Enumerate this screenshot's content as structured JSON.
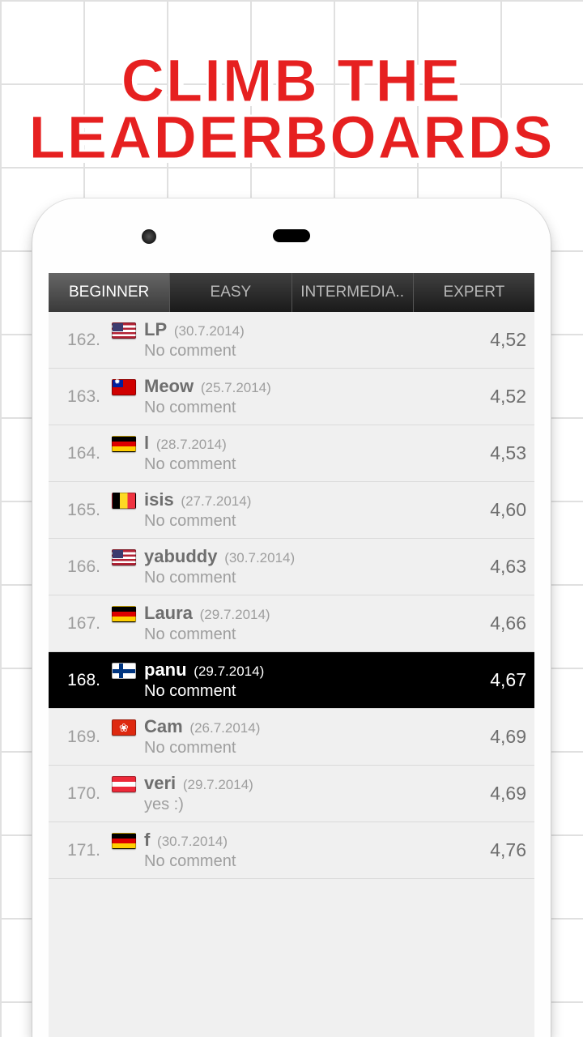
{
  "title_line1": "CLIMB THE",
  "title_line2": "LEADERBOARDS",
  "tabs": [
    {
      "label": "BEGINNER",
      "active": true
    },
    {
      "label": "EASY",
      "active": false
    },
    {
      "label": "INTERMEDIA..",
      "active": false
    },
    {
      "label": "EXPERT",
      "active": false
    }
  ],
  "entries": [
    {
      "rank": "162.",
      "flag": "us",
      "name": "LP",
      "date": "(30.7.2014)",
      "comment": "No comment",
      "score": "4,52",
      "highlight": false
    },
    {
      "rank": "163.",
      "flag": "tw",
      "name": "Meow",
      "date": "(25.7.2014)",
      "comment": "No comment",
      "score": "4,52",
      "highlight": false
    },
    {
      "rank": "164.",
      "flag": "de",
      "name": "l",
      "date": "(28.7.2014)",
      "comment": "No comment",
      "score": "4,53",
      "highlight": false
    },
    {
      "rank": "165.",
      "flag": "be",
      "name": "isis",
      "date": "(27.7.2014)",
      "comment": "No comment",
      "score": "4,60",
      "highlight": false
    },
    {
      "rank": "166.",
      "flag": "us",
      "name": "yabuddy",
      "date": "(30.7.2014)",
      "comment": "No comment",
      "score": "4,63",
      "highlight": false
    },
    {
      "rank": "167.",
      "flag": "de",
      "name": "Laura",
      "date": "(29.7.2014)",
      "comment": "No comment",
      "score": "4,66",
      "highlight": false
    },
    {
      "rank": "168.",
      "flag": "fi",
      "name": "panu",
      "date": "(29.7.2014)",
      "comment": "No comment",
      "score": "4,67",
      "highlight": true
    },
    {
      "rank": "169.",
      "flag": "hk",
      "name": "Cam",
      "date": "(26.7.2014)",
      "comment": "No comment",
      "score": "4,69",
      "highlight": false
    },
    {
      "rank": "170.",
      "flag": "at",
      "name": "veri",
      "date": "(29.7.2014)",
      "comment": "yes :)",
      "score": "4,69",
      "highlight": false
    },
    {
      "rank": "171.",
      "flag": "de",
      "name": "f",
      "date": "(30.7.2014)",
      "comment": "No comment",
      "score": "4,76",
      "highlight": false
    }
  ]
}
